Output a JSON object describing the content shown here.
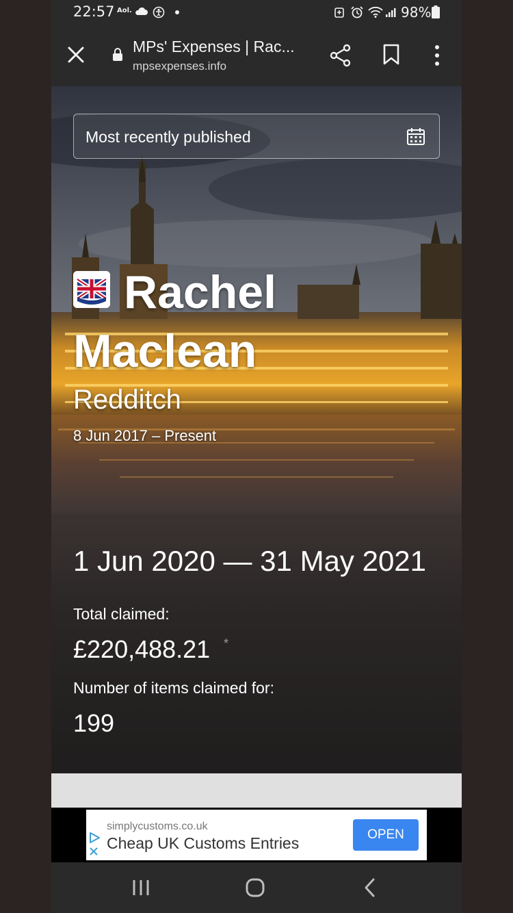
{
  "status_bar": {
    "time": "22:57",
    "aol_label": "Aol.",
    "battery_percent": "98%"
  },
  "browser": {
    "page_title": "MPs' Expenses | Rac...",
    "url": "mpsexpenses.info"
  },
  "filter": {
    "selected": "Most recently published"
  },
  "mp": {
    "name": "Rachel Maclean",
    "constituency": "Redditch",
    "term": "8 Jun 2017 – Present"
  },
  "stats": {
    "period": "1 Jun 2020 — 31 May 2021",
    "total_label": "Total claimed:",
    "total_value": "£220,488.21",
    "total_asterisk": "*",
    "items_label": "Number of items claimed for:",
    "items_value": "199"
  },
  "ad": {
    "domain": "simplycustoms.co.uk",
    "headline": "Cheap UK Customs Entries",
    "button_label": "OPEN"
  },
  "colors": {
    "ad_button": "#3a86f0",
    "browser_bar": "#2a2a2a"
  }
}
